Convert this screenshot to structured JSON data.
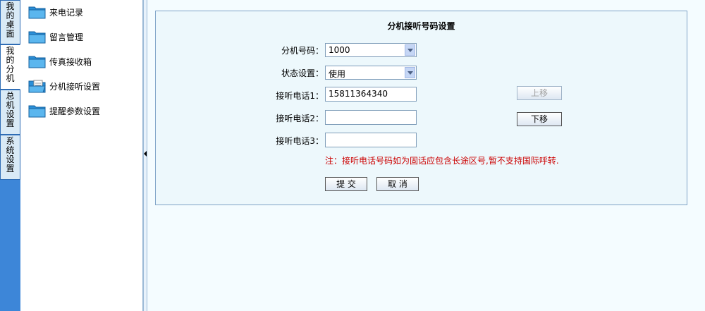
{
  "tabs": [
    {
      "label": "我的桌面",
      "chars": [
        "我",
        "的",
        "桌",
        "面"
      ]
    },
    {
      "label": "我的分机",
      "chars": [
        "我",
        "的",
        "分",
        "机"
      ]
    },
    {
      "label": "总机设置",
      "chars": [
        "总",
        "机",
        "设",
        "置"
      ]
    },
    {
      "label": "系统设置",
      "chars": [
        "系",
        "统",
        "设",
        "置"
      ]
    }
  ],
  "active_tab": "我的分机",
  "nav": {
    "items": [
      {
        "label": "来电记录",
        "icon": "folder-icon"
      },
      {
        "label": "留言管理",
        "icon": "folder-icon"
      },
      {
        "label": "传真接收箱",
        "icon": "folder-icon"
      },
      {
        "label": "分机接听设置",
        "icon": "folder-document-icon"
      },
      {
        "label": "提醒参数设置",
        "icon": "folder-icon"
      }
    ]
  },
  "form": {
    "title": "分机接听号码设置",
    "extension_label": "分机号码：",
    "extension_value": "1000",
    "status_label": "状态设置：",
    "status_value": "使用",
    "phone1_label": "接听电话1：",
    "phone1_value": "15811364340",
    "phone2_label": "接听电话2：",
    "phone2_value": "",
    "phone3_label": "接听电话3：",
    "phone3_value": "",
    "move_up_label": "上移",
    "move_down_label": "下移",
    "note": "注：接听电话号码如为固话应包含长途区号,暂不支持国际呼转.",
    "submit_label": "提 交",
    "cancel_label": "取 消"
  },
  "colors": {
    "tab_strip": "#3d86d8",
    "panel_border": "#7fa3c7",
    "note": "#cc0000"
  }
}
